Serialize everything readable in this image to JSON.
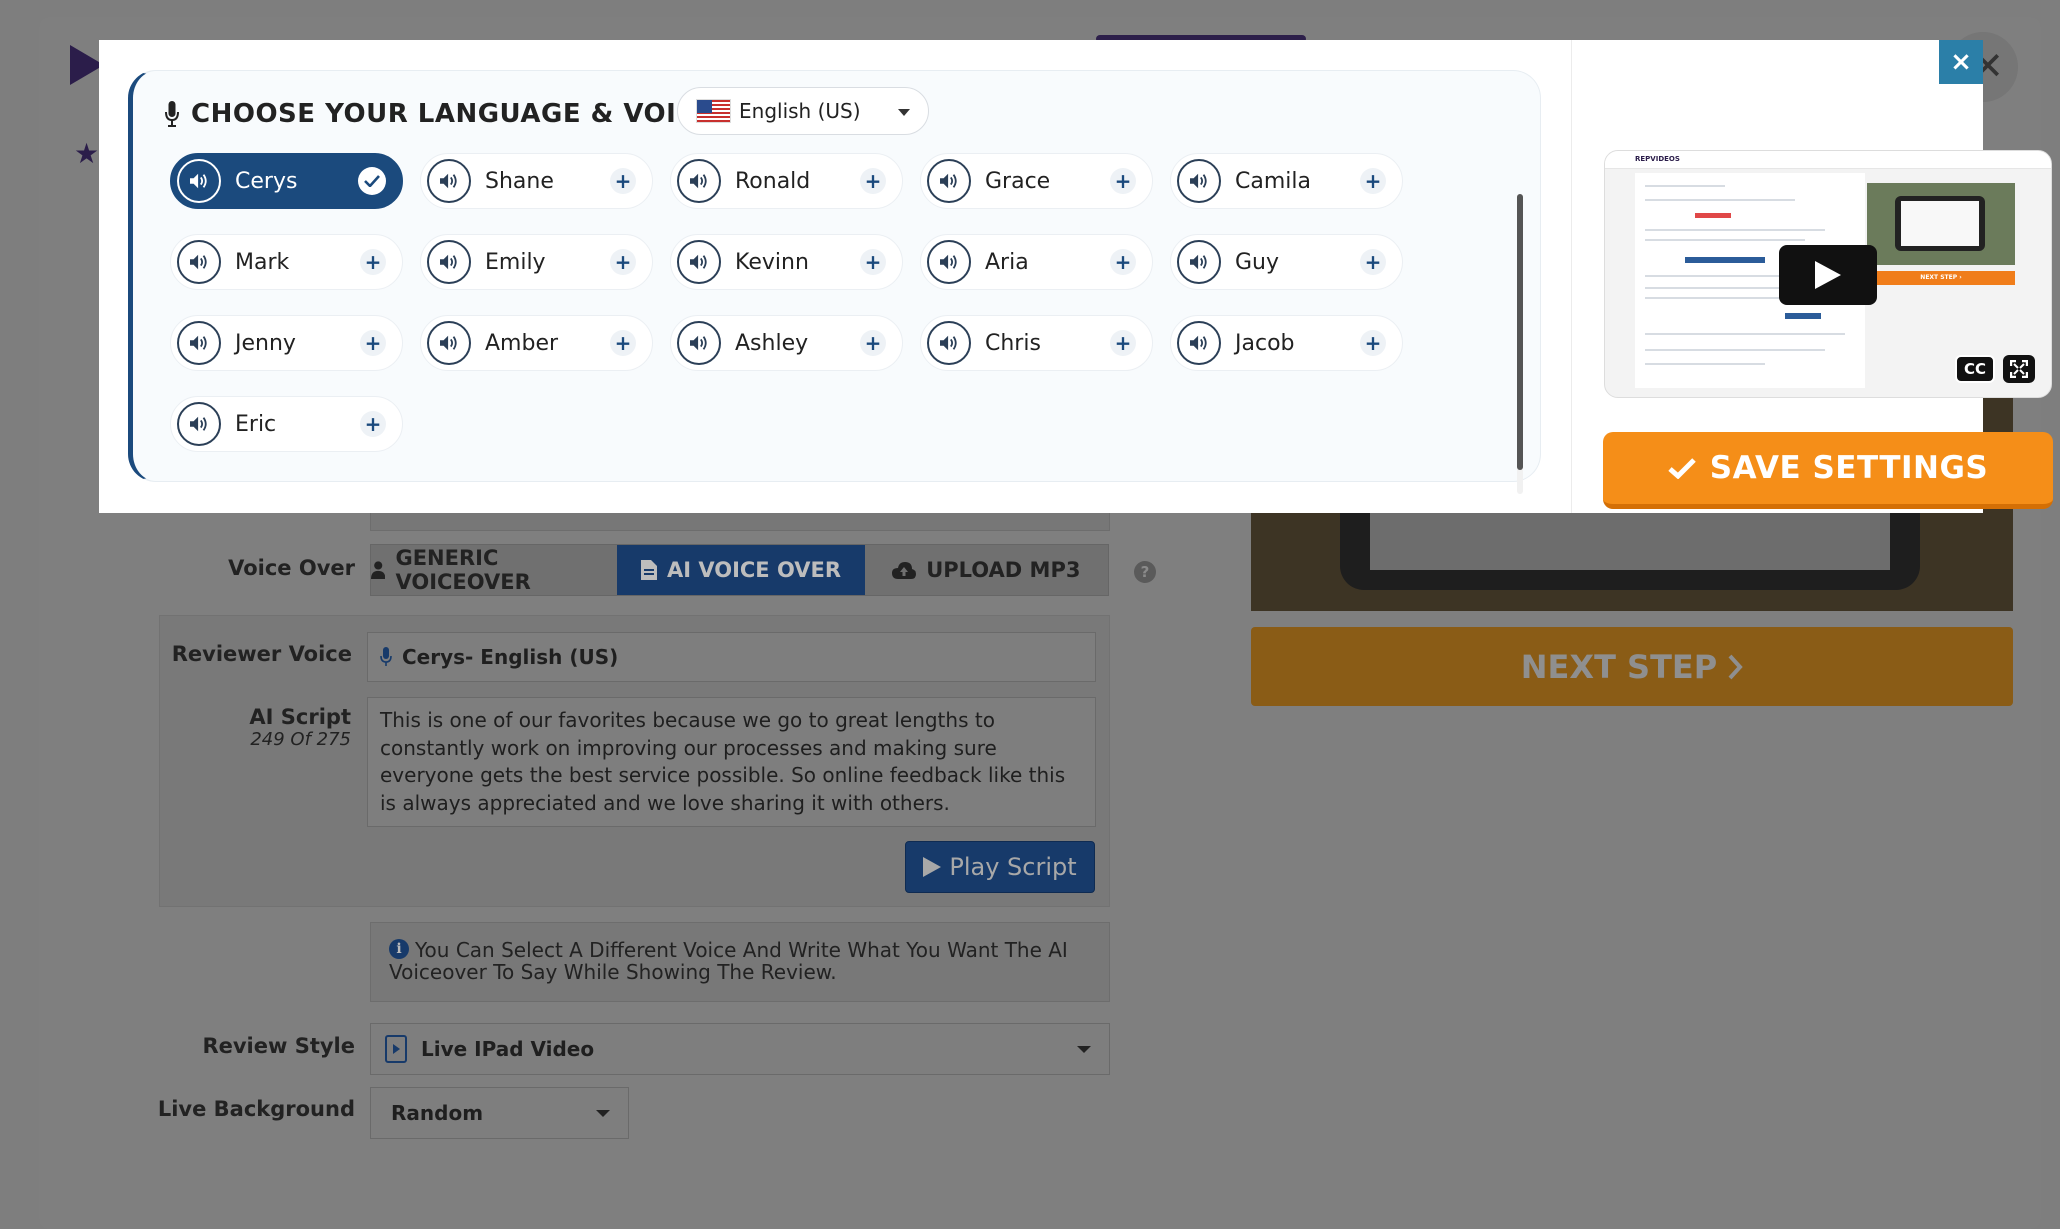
{
  "modal": {
    "title": "CHOOSE YOUR LANGUAGE & VOICE",
    "language": "English (US)",
    "voices": [
      {
        "name": "Cerys",
        "selected": true
      },
      {
        "name": "Shane"
      },
      {
        "name": "Ronald"
      },
      {
        "name": "Grace"
      },
      {
        "name": "Camila"
      },
      {
        "name": "Mark"
      },
      {
        "name": "Emily"
      },
      {
        "name": "Kevinn"
      },
      {
        "name": "Aria"
      },
      {
        "name": "Guy"
      },
      {
        "name": "Jenny"
      },
      {
        "name": "Amber"
      },
      {
        "name": "Ashley"
      },
      {
        "name": "Chris"
      },
      {
        "name": "Jacob"
      },
      {
        "name": "Eric"
      }
    ],
    "save_label": "SAVE SETTINGS",
    "close_label": "×",
    "video": {
      "brand": "REPVIDEOS",
      "cc_label": "CC",
      "next_step_label": "NEXT STEP ›"
    }
  },
  "form": {
    "voice_over_label": "Voice Over",
    "voice_over_options": [
      "GENERIC VOICEOVER",
      "AI VOICE OVER",
      "UPLOAD MP3"
    ],
    "voice_over_active": "AI VOICE OVER",
    "help_label": "?",
    "reviewer_voice_label": "Reviewer Voice",
    "reviewer_voice_value": "Cerys- English (US)",
    "ai_script_label": "AI Script",
    "ai_script_count": "249 Of 275",
    "ai_script_text": "This is one of our favorites because we go to great lengths to constantly work on improving our processes and making sure everyone gets the best service possible. So online feedback like this is always appreciated and we love sharing it with others.",
    "play_script_label": "Play Script",
    "info_text": "You Can Select A Different Voice And Write What You Want The AI Voiceover To Say While Showing The Review.",
    "review_style_label": "Review Style",
    "review_style_value": "Live IPad Video",
    "live_background_label": "Live Background",
    "live_background_value": "Random"
  },
  "preview": {
    "next_step_label": "NEXT STEP"
  },
  "colors": {
    "primary": "#1b4a7d",
    "accent_orange": "#f58e18",
    "close_blue": "#2b7fa8"
  }
}
